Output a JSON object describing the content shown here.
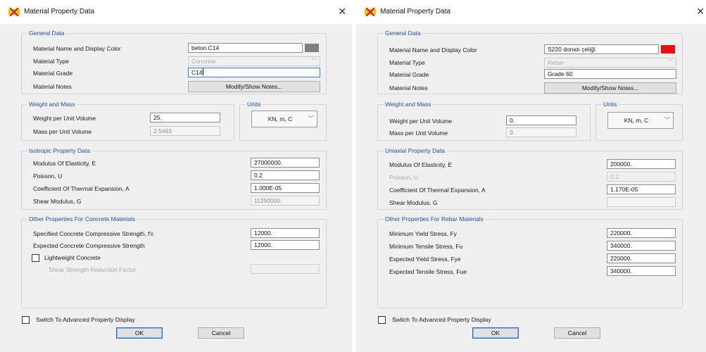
{
  "left": {
    "title": "Material Property Data",
    "general": {
      "legend": "General Data",
      "name_label": "Material Name and Display Color",
      "name_value": "beton C14",
      "color": "#808080",
      "type_label": "Material Type",
      "type_value": "Concrete",
      "grade_label": "Material Grade",
      "grade_value": "C14",
      "notes_label": "Material Notes",
      "notes_button": "Modify/Show Notes..."
    },
    "weight": {
      "legend": "Weight and Mass",
      "wpuv_label": "Weight per Unit Volume",
      "wpuv_value": "25.",
      "mpuv_label": "Mass per Unit Volume",
      "mpuv_value": "2.5493"
    },
    "units": {
      "legend": "Units",
      "value": "KN, m, C"
    },
    "prop": {
      "legend": "Isotropic Property Data",
      "rows": [
        {
          "label": "Modulus Of Elasticity,  E",
          "value": "27000000."
        },
        {
          "label": "Poisson,  U",
          "value": "0.2"
        },
        {
          "label": "Coefficient Of Thermal Expansion,  A",
          "value": "1.000E-05"
        },
        {
          "label": "Shear Modulus,  G",
          "value": "11250000."
        }
      ]
    },
    "other": {
      "legend": "Other Properties For Concrete Materials",
      "rows": [
        {
          "label": "Specified Concrete Compressive Strength, f'c",
          "value": "12000."
        },
        {
          "label": "Expected Concrete Compressive Strength",
          "value": "12000."
        }
      ],
      "lightweight_label": "Lightweight Concrete",
      "shear_factor_label": "Shear Strength Reduction Factor"
    },
    "advanced_label": "Switch To Advanced Property Display",
    "ok": "OK",
    "cancel": "Cancel"
  },
  "right": {
    "title": "Material Property Data",
    "general": {
      "legend": "General Data",
      "name_label": "Material Name and Display Color",
      "name_value": "S220 donatı çeliği",
      "color": "#e81010",
      "type_label": "Material Type",
      "type_value": "Rebar",
      "grade_label": "Material Grade",
      "grade_value": "Grade 60",
      "notes_label": "Material Notes",
      "notes_button": "Modify/Show Notes..."
    },
    "weight": {
      "legend": "Weight and Mass",
      "wpuv_label": "Weight per Unit Volume",
      "wpuv_value": "0.",
      "mpuv_label": "Mass per Unit Volume",
      "mpuv_value": "0."
    },
    "units": {
      "legend": "Units",
      "value": "KN, m, C"
    },
    "prop": {
      "legend": "Uniaxial Property Data",
      "rows": [
        {
          "label": "Modulus Of Elasticity,  E",
          "value": "200000."
        },
        {
          "label": "Poisson,  U",
          "value": "0.3"
        },
        {
          "label": "Coefficient Of Thermal Expansion,  A",
          "value": "1.170E-05"
        },
        {
          "label": "Shear Modulus,  G",
          "value": ""
        }
      ]
    },
    "other": {
      "legend": "Other Properties For Rebar Materials",
      "rows": [
        {
          "label": "Minimum Yield Stress, Fy",
          "value": "220000."
        },
        {
          "label": "Minimum Tensile Stress, Fu",
          "value": "340000."
        },
        {
          "label": "Expected Yield Stress, Fye",
          "value": "220000."
        },
        {
          "label": "Expected Tensile Stress, Fue",
          "value": "340000."
        }
      ]
    },
    "advanced_label": "Switch To Advanced Property Display",
    "ok": "OK",
    "cancel": "Cancel"
  },
  "icons": {
    "app": "sap2000-app-icon",
    "close": "close-icon",
    "dropdown": "chevron-down-icon"
  },
  "colors": {
    "accent_blue": "#1f4fa8",
    "default_button_border": "#2a6fd6"
  }
}
